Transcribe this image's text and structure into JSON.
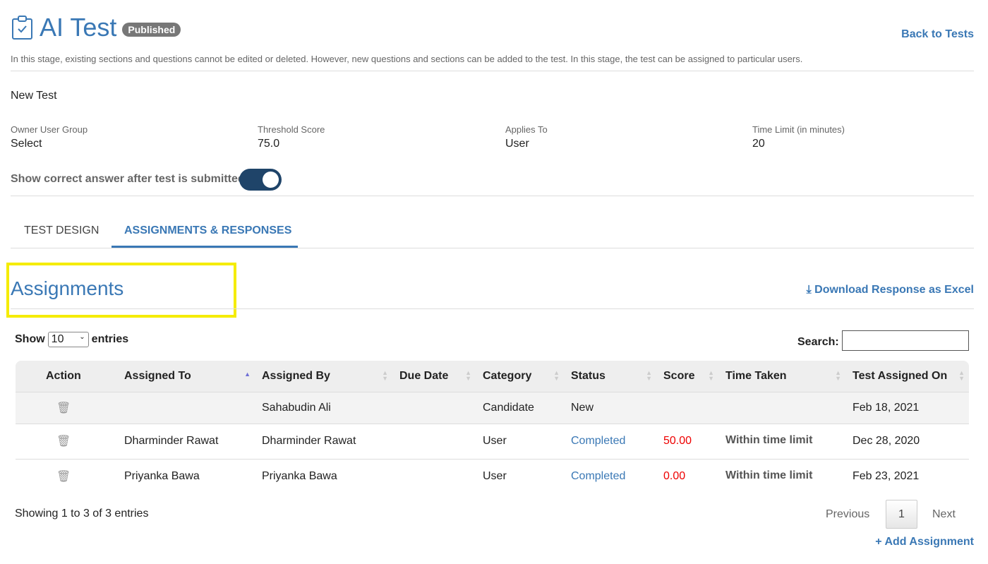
{
  "header": {
    "title": "AI Test",
    "badge": "Published",
    "back": "Back to Tests",
    "description": "In this stage, existing sections and questions cannot be edited or deleted. However, new questions and sections can be added to the test. In this stage, the test can be assigned to particular users."
  },
  "test_name": "New Test",
  "fields": [
    {
      "label": "Owner User Group",
      "value": "Select"
    },
    {
      "label": "Threshold Score",
      "value": "75.0"
    },
    {
      "label": "Applies To",
      "value": "User"
    },
    {
      "label": "Time Limit (in minutes)",
      "value": "20"
    }
  ],
  "toggle": {
    "label": "Show correct answer after test is submitted",
    "on": true
  },
  "tabs": [
    "TEST DESIGN",
    "ASSIGNMENTS & RESPONSES"
  ],
  "section": {
    "title": "Assignments",
    "download": "Download Response as Excel"
  },
  "controls": {
    "show": "Show",
    "entries_value": "10",
    "entries": "entries",
    "search": "Search:"
  },
  "table": {
    "headers": [
      "Action",
      "Assigned To",
      "Assigned By",
      "Due Date",
      "Category",
      "Status",
      "Score",
      "Time Taken",
      "Test Assigned On"
    ],
    "rows": [
      {
        "to": "",
        "by": "Sahabudin Ali",
        "due": "",
        "cat": "Candidate",
        "status": "New",
        "score": "",
        "time": "",
        "on": "Feb 18, 2021"
      },
      {
        "to": "Dharminder Rawat",
        "by": "Dharminder Rawat",
        "due": "",
        "cat": "User",
        "status": "Completed",
        "score": "50.00",
        "time": "Within time limit",
        "on": "Dec 28, 2020"
      },
      {
        "to": "Priyanka Bawa",
        "by": "Priyanka Bawa",
        "due": "",
        "cat": "User",
        "status": "Completed",
        "score": "0.00",
        "time": "Within time limit",
        "on": "Feb 23, 2021"
      }
    ]
  },
  "footer": {
    "info": "Showing 1 to 3 of 3 entries",
    "prev": "Previous",
    "page": "1",
    "next": "Next",
    "add": "+ Add Assignment"
  }
}
